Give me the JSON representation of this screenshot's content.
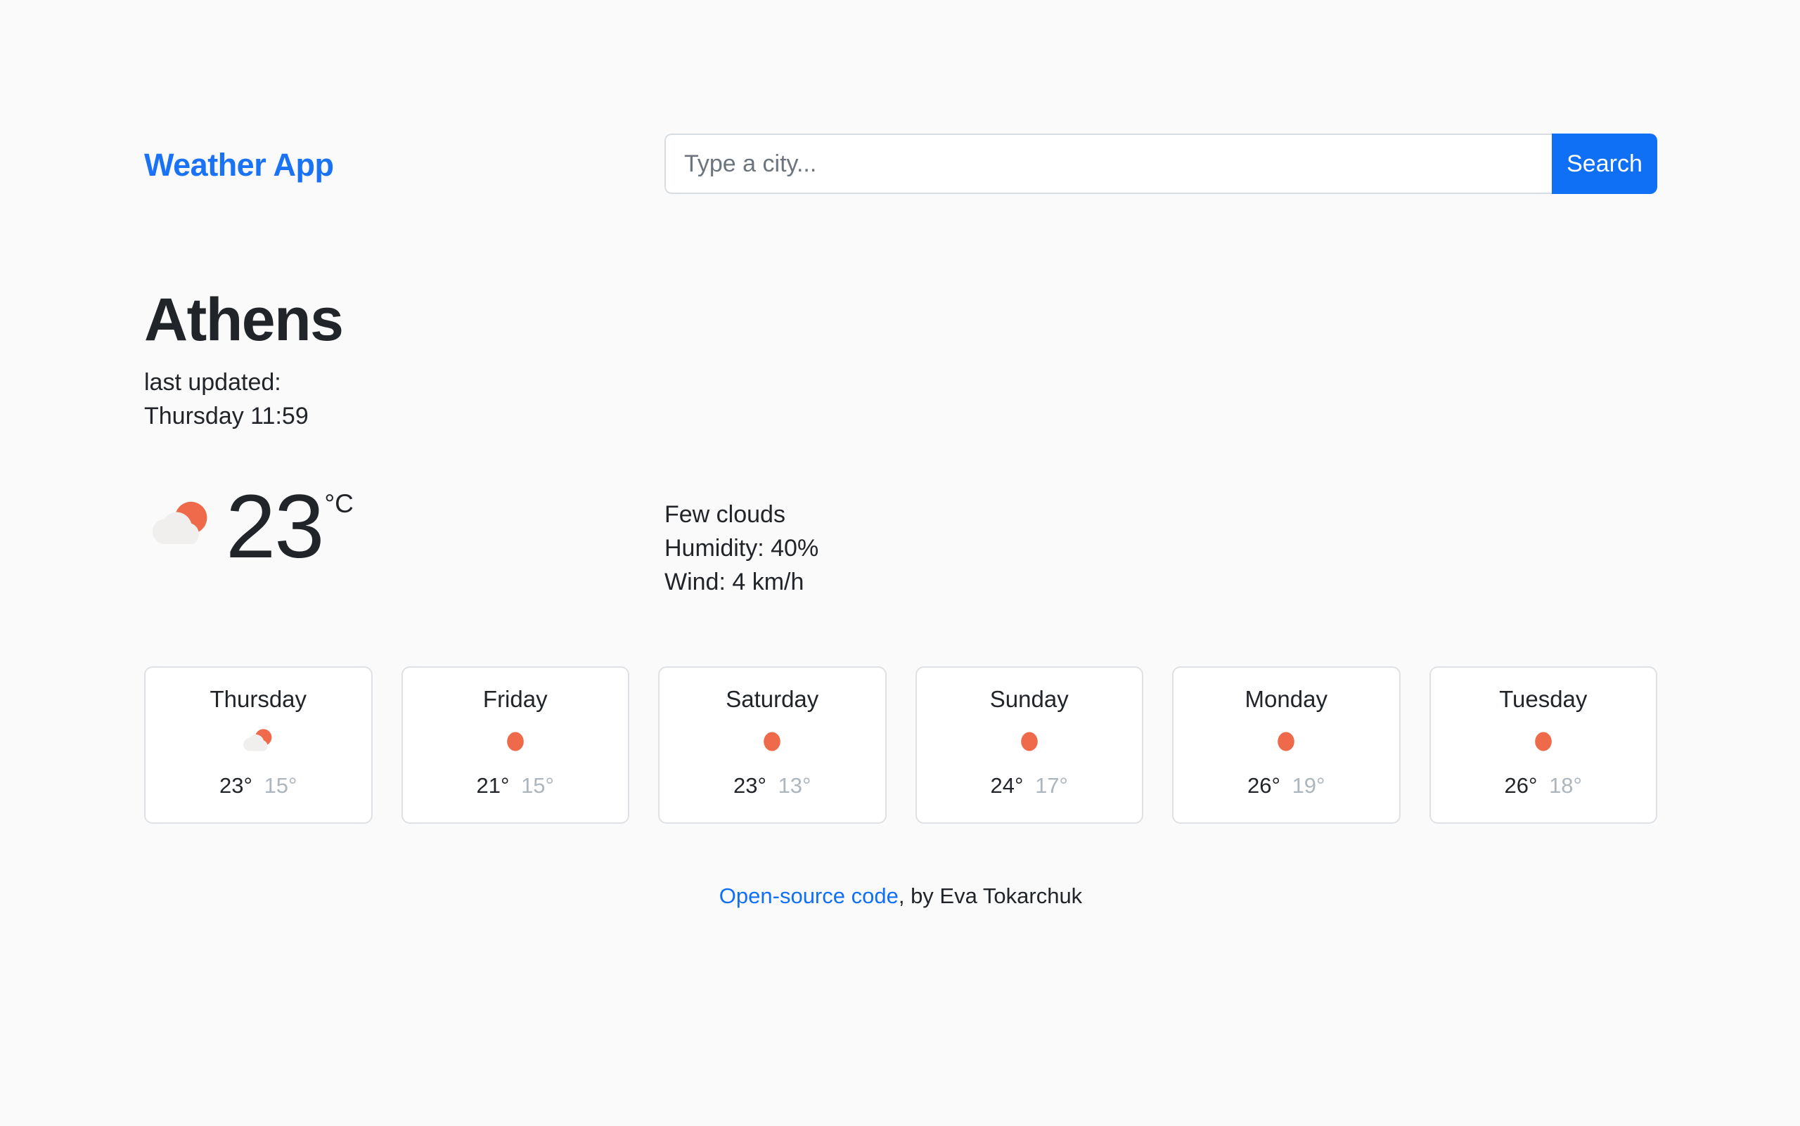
{
  "brand": {
    "title": "Weather App",
    "color": "#1a73f5"
  },
  "search": {
    "placeholder": "Type a city...",
    "value": "",
    "button_label": "Search",
    "button_color": "#1070f5"
  },
  "current": {
    "city": "Athens",
    "updated_label": "last updated:",
    "updated_time": "Thursday 11:59",
    "icon": "sun-behind-cloud-icon",
    "temperature": "23",
    "unit": "°C",
    "description": "Few clouds",
    "humidity": "Humidity: 40%",
    "wind": "Wind: 4 km/h"
  },
  "forecast": {
    "days": [
      {
        "day": "Thursday",
        "icon": "sun-behind-cloud-icon",
        "max": "23°",
        "min": "15°"
      },
      {
        "day": "Friday",
        "icon": "sun-icon",
        "max": "21°",
        "min": "15°"
      },
      {
        "day": "Saturday",
        "icon": "sun-icon",
        "max": "23°",
        "min": "13°"
      },
      {
        "day": "Sunday",
        "icon": "sun-icon",
        "max": "24°",
        "min": "17°"
      },
      {
        "day": "Monday",
        "icon": "sun-icon",
        "max": "26°",
        "min": "19°"
      },
      {
        "day": "Tuesday",
        "icon": "sun-icon",
        "max": "26°",
        "min": "18°"
      }
    ]
  },
  "footer": {
    "link_text": "Open-source code",
    "rest_text": ", by Eva Tokarchuk"
  },
  "colors": {
    "page_background": "#fafafa",
    "card_background": "#ffffff",
    "card_border": "#dee2e6",
    "text_primary": "#212529",
    "text_muted": "#adb5bd",
    "accent_blue": "#1070f5",
    "sun_orange": "#ee6a4a",
    "cloud_gray": "#f0efed"
  }
}
